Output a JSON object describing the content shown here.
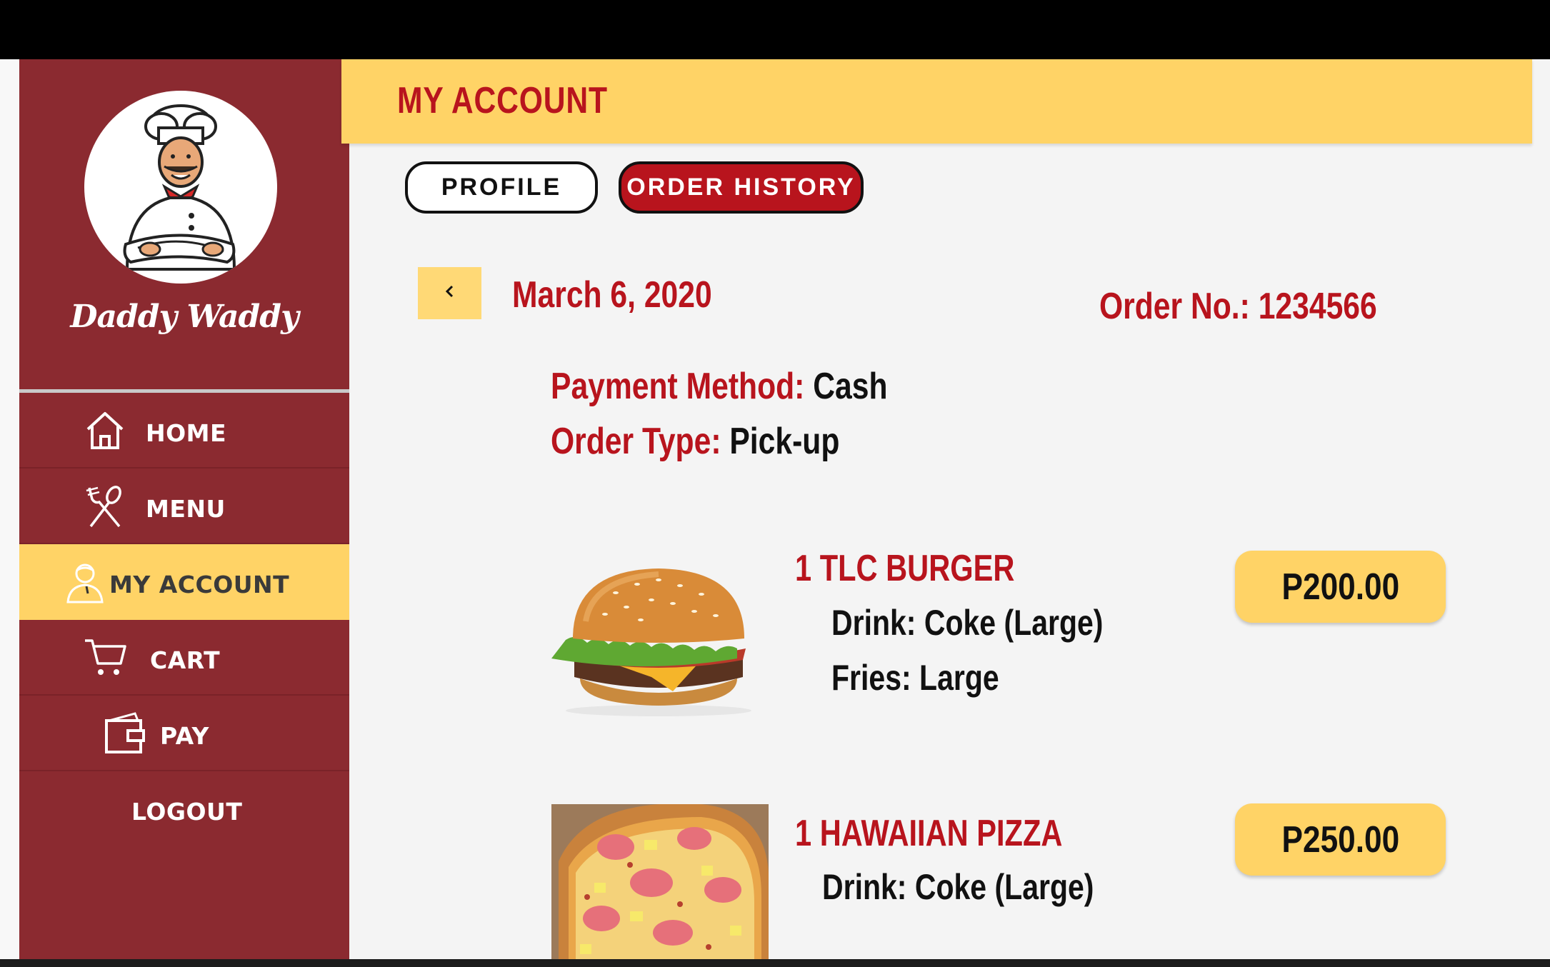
{
  "app": {
    "brand_name": "Daddy Waddy",
    "colors": {
      "primary_red": "#b8141d",
      "sidebar": "#8b2a30",
      "accent_yellow": "#ffd366"
    }
  },
  "sidebar": {
    "items": [
      {
        "label": "HOME",
        "icon": "home-icon",
        "active": false
      },
      {
        "label": "MENU",
        "icon": "fork-knife-icon",
        "active": false
      },
      {
        "label": "MY ACCOUNT",
        "icon": "user-icon",
        "active": true
      },
      {
        "label": "CART",
        "icon": "cart-icon",
        "active": false
      },
      {
        "label": "PAY",
        "icon": "wallet-icon",
        "active": false
      },
      {
        "label": "LOGOUT",
        "icon": "",
        "active": false
      }
    ]
  },
  "header": {
    "title": "MY ACCOUNT"
  },
  "tabs": {
    "profile": "PROFILE",
    "order_history": "ORDER HISTORY"
  },
  "order": {
    "date": "March 6, 2020",
    "number_label": "Order No.:",
    "number": "1234566",
    "payment_label": "Payment Method:",
    "payment_value": "Cash",
    "type_label": "Order Type:",
    "type_value": "Pick-up",
    "items": [
      {
        "name": "1 TLC BURGER",
        "details": [
          "Drink: Coke (Large)",
          "Fries: Large"
        ],
        "price": "P200.00",
        "image": "burger-image"
      },
      {
        "name": "1 HAWAIIAN PIZZA",
        "details": [
          "Drink: Coke (Large)"
        ],
        "price": "P250.00",
        "image": "pizza-image"
      }
    ]
  }
}
